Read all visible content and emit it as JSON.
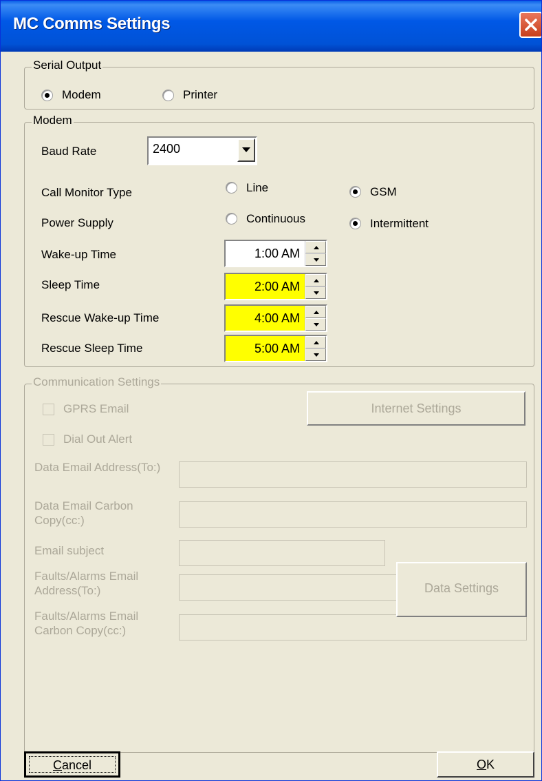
{
  "window": {
    "title": "MC Comms Settings",
    "close_icon": "close-icon"
  },
  "serial_output": {
    "title": "Serial Output",
    "options": [
      {
        "label": "Modem",
        "selected": true
      },
      {
        "label": "Printer",
        "selected": false
      }
    ]
  },
  "modem": {
    "title": "Modem",
    "baud_rate": {
      "label": "Baud Rate",
      "value": "2400"
    },
    "call_monitor": {
      "label": "Call Monitor Type",
      "options": [
        {
          "label": "Line",
          "selected": false
        },
        {
          "label": "GSM",
          "selected": true
        }
      ]
    },
    "power_supply": {
      "label": "Power Supply",
      "options": [
        {
          "label": "Continuous",
          "selected": false
        },
        {
          "label": "Intermittent",
          "selected": true
        }
      ]
    },
    "times": [
      {
        "label": "Wake-up Time",
        "value": "1:00 AM",
        "highlight": false
      },
      {
        "label": "Sleep Time",
        "value": "2:00 AM",
        "highlight": true
      },
      {
        "label": "Rescue Wake-up Time",
        "value": "4:00 AM",
        "highlight": true
      },
      {
        "label": "Rescue Sleep Time",
        "value": "5:00 AM",
        "highlight": true
      }
    ]
  },
  "comm": {
    "title": "Communication Settings",
    "gprs_email": "GPRS Email",
    "dial_out_alert": "Dial Out Alert",
    "internet_settings": "Internet Settings",
    "data_email_to": "Data Email Address(To:)",
    "data_email_cc": "Data Email Carbon Copy(cc:)",
    "email_subject": "Email subject",
    "faults_email_to": "Faults/Alarms Email Address(To:)",
    "faults_email_cc": "Faults/Alarms Email Carbon Copy(cc:)",
    "data_settings": "Data Settings"
  },
  "buttons": {
    "cancel_first": "C",
    "cancel_rest": "ancel",
    "ok_first": "O",
    "ok_rest": "K"
  },
  "colors": {
    "highlight": "#ffff00",
    "titlebar": "#0054e3",
    "dialog_bg": "#ece9d8",
    "disabled_text": "#aca899"
  }
}
